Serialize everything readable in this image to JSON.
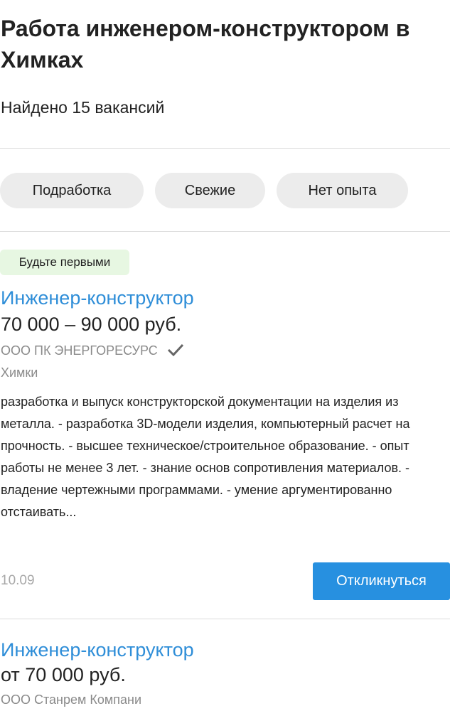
{
  "header": {
    "title": "Работа инженером-конструктором в Химках",
    "found_count": "Найдено 15 вакансий"
  },
  "filters": [
    {
      "label": "Подработка"
    },
    {
      "label": "Свежие"
    },
    {
      "label": "Нет опыта"
    }
  ],
  "vacancies": [
    {
      "badge": "Будьте первыми",
      "title": "Инженер-конструктор",
      "salary": "70 000 – 90 000 руб.",
      "company": "ООО ПК ЭНЕРГОРЕСУРС",
      "verified_icon": "checkmark-icon",
      "city": "Химки",
      "description": "разработка и выпуск конструкторской документации на изделия из металла. - разработка 3D-модели изделия, компьютерный расчет на прочность. - высшее техническое/строительное образование. - опыт работы не менее 3 лет. - знание основ сопротивления материалов. - владение чертежными программами. - умение аргументированно отстаивать...",
      "date": "10.09",
      "respond_label": "Откликнуться"
    },
    {
      "title": "Инженер-конструктор",
      "salary": "от 70 000 руб.",
      "company": "ООО Станрем Компани"
    }
  ],
  "colors": {
    "link": "#2f8ed8",
    "button": "#2790e0",
    "badge_bg": "#e7f7e2",
    "chip_bg": "#ececec",
    "muted": "#8a8a8a"
  }
}
